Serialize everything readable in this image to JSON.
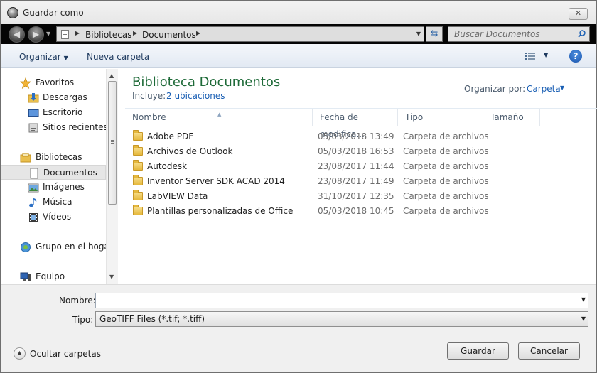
{
  "window": {
    "title": "Guardar como",
    "close_symbol": "✕"
  },
  "address_bar": {
    "crumbs": [
      "Bibliotecas",
      "Documentos"
    ],
    "search_placeholder": "Buscar Documentos"
  },
  "toolbar": {
    "organize_label": "Organizar",
    "new_folder_label": "Nueva carpeta",
    "help_symbol": "?"
  },
  "nav_pane": {
    "items": [
      {
        "label": "Favoritos",
        "icon": "star-icon",
        "group": true
      },
      {
        "label": "Descargas",
        "icon": "downloads-folder-icon"
      },
      {
        "label": "Escritorio",
        "icon": "desktop-icon"
      },
      {
        "label": "Sitios recientes",
        "icon": "recent-places-icon"
      },
      {
        "label": "Bibliotecas",
        "icon": "libraries-icon",
        "group": true
      },
      {
        "label": "Documentos",
        "icon": "documents-icon",
        "selected": true
      },
      {
        "label": "Imágenes",
        "icon": "pictures-icon"
      },
      {
        "label": "Música",
        "icon": "music-icon"
      },
      {
        "label": "Vídeos",
        "icon": "videos-icon"
      },
      {
        "label": "Grupo en el hogar",
        "icon": "homegroup-icon",
        "group": true
      },
      {
        "label": "Equipo",
        "icon": "computer-icon",
        "group": true
      }
    ]
  },
  "content": {
    "library_title": "Biblioteca Documentos",
    "includes_label": "Incluye:",
    "includes_link": "2 ubicaciones",
    "arrange_label": "Organizar por:",
    "arrange_value": "Carpeta",
    "columns": [
      "Nombre",
      "Fecha de modifica...",
      "Tipo",
      "Tamaño"
    ],
    "rows": [
      {
        "name": "Adobe PDF",
        "date": "05/03/2018 13:49",
        "type": "Carpeta de archivos"
      },
      {
        "name": "Archivos de Outlook",
        "date": "05/03/2018 16:53",
        "type": "Carpeta de archivos"
      },
      {
        "name": "Autodesk",
        "date": "23/08/2017 11:44",
        "type": "Carpeta de archivos"
      },
      {
        "name": "Inventor Server SDK ACAD 2014",
        "date": "23/08/2017 11:49",
        "type": "Carpeta de archivos"
      },
      {
        "name": "LabVIEW Data",
        "date": "31/10/2017 12:35",
        "type": "Carpeta de archivos"
      },
      {
        "name": "Plantillas personalizadas de Office",
        "date": "05/03/2018 10:45",
        "type": "Carpeta de archivos"
      }
    ]
  },
  "footer": {
    "filename_label": "Nombre:",
    "filename_value": "",
    "type_label": "Tipo:",
    "type_value": "GeoTIFF Files (*.tif; *.tiff)",
    "hide_folders_label": "Ocultar carpetas",
    "save_label": "Guardar",
    "cancel_label": "Cancelar"
  }
}
